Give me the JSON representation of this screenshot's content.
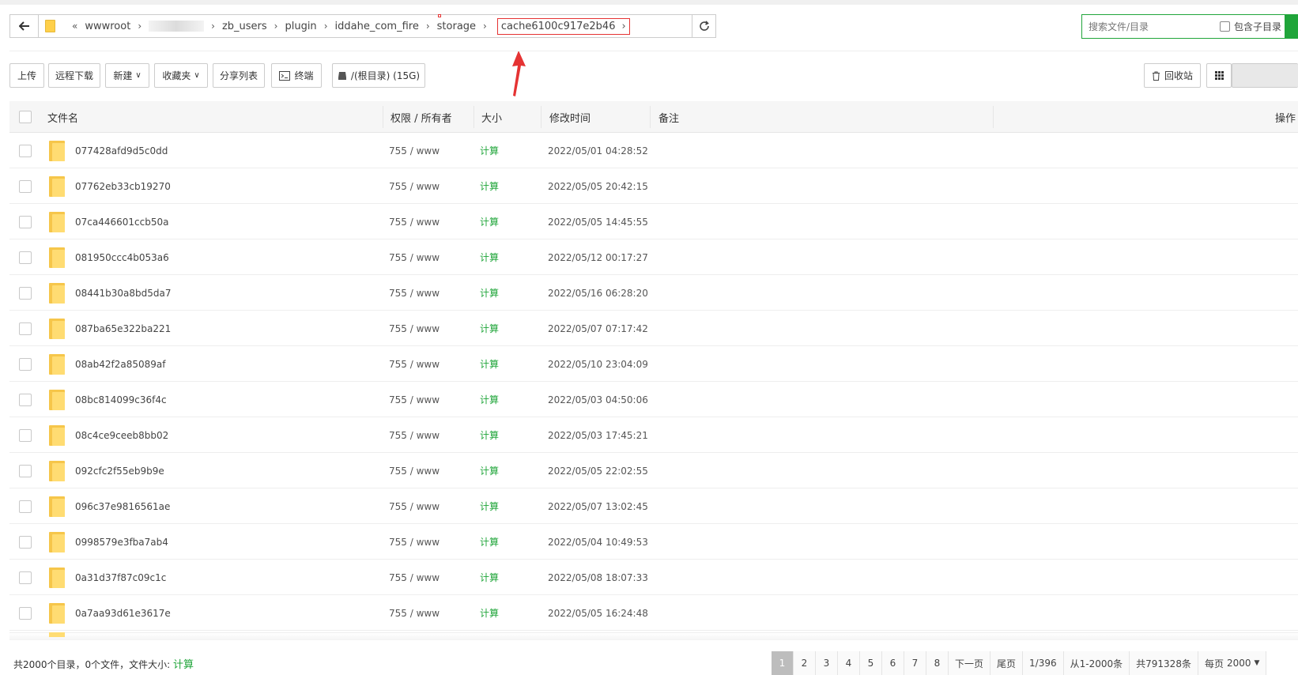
{
  "address": {
    "overflow": "«",
    "crumbs": [
      "wwwroot",
      "zb_users",
      "plugin",
      "iddahe_com_fire",
      "storage"
    ],
    "current": "cache6100c917e2b46"
  },
  "search": {
    "placeholder": "搜索文件/目录",
    "subdir_label": "包含子目录"
  },
  "toolbar": {
    "upload": "上传",
    "remote_download": "远程下载",
    "new": "新建",
    "favorites": "收藏夹",
    "share_list": "分享列表",
    "terminal": "终端",
    "disk": "/(根目录) (15G)",
    "recycle": "回收站"
  },
  "table": {
    "headers": {
      "name": "文件名",
      "perm": "权限 / 所有者",
      "size": "大小",
      "mtime": "修改时间",
      "remark": "备注",
      "ops": "操作"
    },
    "rows": [
      {
        "name": "077428afd9d5c0dd",
        "perm": "755 / www",
        "size": "计算",
        "mtime": "2022/05/01 04:28:52"
      },
      {
        "name": "07762eb33cb19270",
        "perm": "755 / www",
        "size": "计算",
        "mtime": "2022/05/05 20:42:15"
      },
      {
        "name": "07ca446601ccb50a",
        "perm": "755 / www",
        "size": "计算",
        "mtime": "2022/05/05 14:45:55"
      },
      {
        "name": "081950ccc4b053a6",
        "perm": "755 / www",
        "size": "计算",
        "mtime": "2022/05/12 00:17:27"
      },
      {
        "name": "08441b30a8bd5da7",
        "perm": "755 / www",
        "size": "计算",
        "mtime": "2022/05/16 06:28:20"
      },
      {
        "name": "087ba65e322ba221",
        "perm": "755 / www",
        "size": "计算",
        "mtime": "2022/05/07 07:17:42"
      },
      {
        "name": "08ab42f2a85089af",
        "perm": "755 / www",
        "size": "计算",
        "mtime": "2022/05/10 23:04:09"
      },
      {
        "name": "08bc814099c36f4c",
        "perm": "755 / www",
        "size": "计算",
        "mtime": "2022/05/03 04:50:06"
      },
      {
        "name": "08c4ce9ceeb8bb02",
        "perm": "755 / www",
        "size": "计算",
        "mtime": "2022/05/03 17:45:21"
      },
      {
        "name": "092cfc2f55eb9b9e",
        "perm": "755 / www",
        "size": "计算",
        "mtime": "2022/05/05 22:02:55"
      },
      {
        "name": "096c37e9816561ae",
        "perm": "755 / www",
        "size": "计算",
        "mtime": "2022/05/07 13:02:45"
      },
      {
        "name": "0998579e3fba7ab4",
        "perm": "755 / www",
        "size": "计算",
        "mtime": "2022/05/04 10:49:53"
      },
      {
        "name": "0a31d37f87c09c1c",
        "perm": "755 / www",
        "size": "计算",
        "mtime": "2022/05/08 18:07:33"
      },
      {
        "name": "0a7aa93d61e3617e",
        "perm": "755 / www",
        "size": "计算",
        "mtime": "2022/05/05 16:24:48"
      }
    ]
  },
  "footer": {
    "summary": "共2000个目录，0个文件，文件大小:",
    "calc": "计算"
  },
  "pager": {
    "pages": [
      "1",
      "2",
      "3",
      "4",
      "5",
      "6",
      "7",
      "8"
    ],
    "active": "1",
    "next": "下一页",
    "last": "尾页",
    "ratio": "1/396",
    "range": "从1-2000条",
    "total": "共791328条",
    "per_page_label": "每页",
    "per_page_value": "2000"
  },
  "colors": {
    "accent": "#20a53a",
    "highlight_red": "#e53333",
    "folder": "#ffdc72"
  }
}
